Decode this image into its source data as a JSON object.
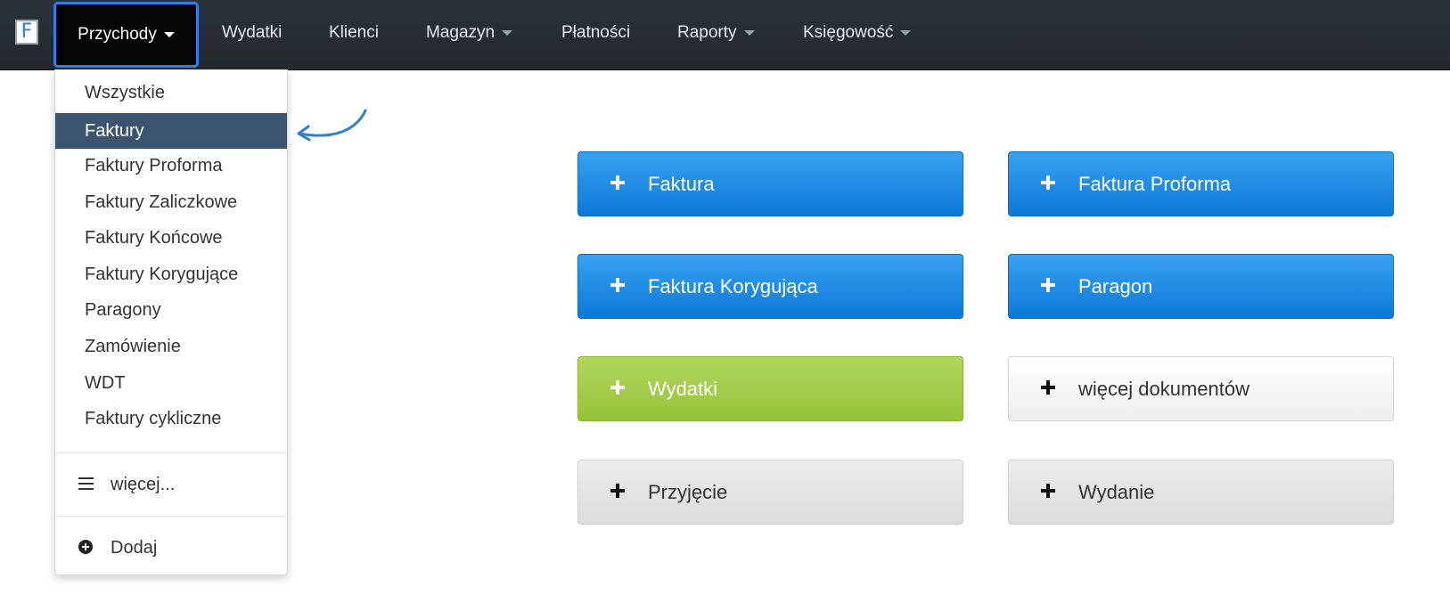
{
  "navbar": {
    "brand_letter": "F",
    "items": [
      {
        "label": "Przychody",
        "has_caret": true,
        "active": true
      },
      {
        "label": "Wydatki",
        "has_caret": false
      },
      {
        "label": "Klienci",
        "has_caret": false
      },
      {
        "label": "Magazyn",
        "has_caret": true
      },
      {
        "label": "Płatności",
        "has_caret": false
      },
      {
        "label": "Raporty",
        "has_caret": true
      },
      {
        "label": "Księgowość",
        "has_caret": true
      }
    ]
  },
  "dropdown": {
    "items": [
      {
        "label": "Wszystkie"
      },
      {
        "label": "Faktury",
        "active": true
      },
      {
        "label": "Faktury Proforma"
      },
      {
        "label": "Faktury Zaliczkowe"
      },
      {
        "label": "Faktury Końcowe"
      },
      {
        "label": "Faktury Korygujące"
      },
      {
        "label": "Paragony"
      },
      {
        "label": "Zamówienie"
      },
      {
        "label": "WDT"
      },
      {
        "label": "Faktury cykliczne"
      }
    ],
    "more_label": "więcej...",
    "more_icon": "list-icon",
    "add_label": "Dodaj",
    "add_icon": "plus-circle-icon"
  },
  "actions": [
    {
      "label": "Faktura",
      "style": "blue",
      "icon": "plus-icon"
    },
    {
      "label": "Faktura Proforma",
      "style": "blue",
      "icon": "plus-icon"
    },
    {
      "label": "Faktura Korygująca",
      "style": "blue",
      "icon": "plus-icon"
    },
    {
      "label": "Paragon",
      "style": "blue",
      "icon": "plus-icon"
    },
    {
      "label": "Wydatki",
      "style": "green",
      "icon": "plus-icon"
    },
    {
      "label": "więcej dokumentów",
      "style": "light",
      "icon": "plus-icon"
    },
    {
      "label": "Przyjęcie",
      "style": "gray",
      "icon": "plus-icon"
    },
    {
      "label": "Wydanie",
      "style": "gray",
      "icon": "plus-icon"
    }
  ],
  "colors": {
    "navbar_bg": "#2c323a",
    "active_highlight_border": "#2f80ed",
    "dropdown_active_bg": "#3b5570",
    "button_blue": "#0a79d9",
    "button_green": "#94c33b",
    "annotation_arrow": "#2f7fd2"
  }
}
